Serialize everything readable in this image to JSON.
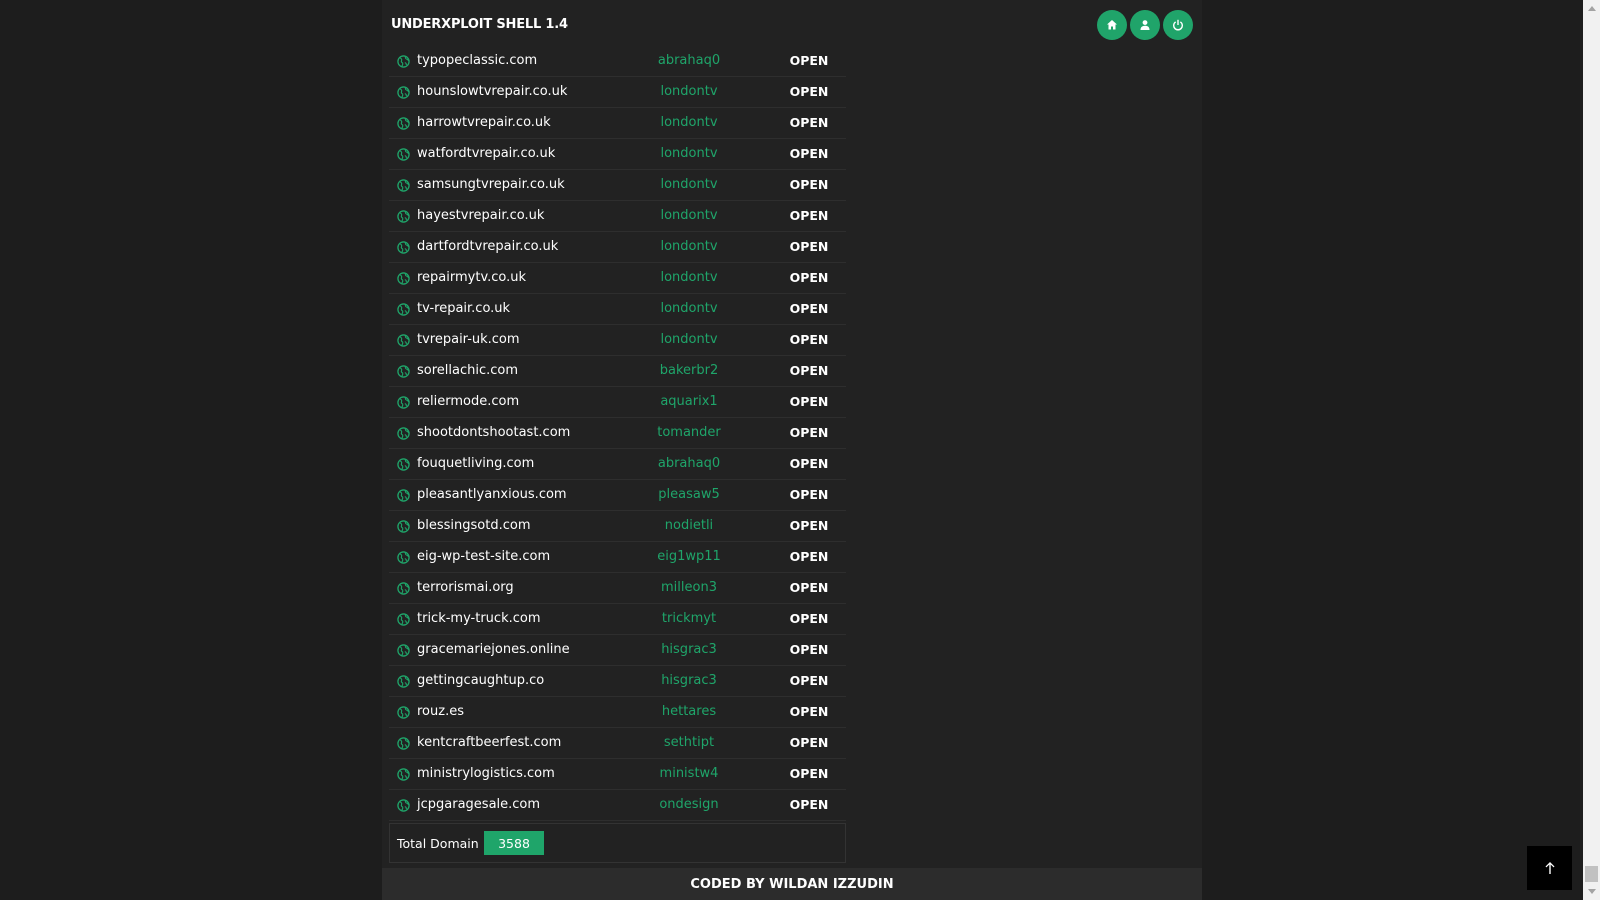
{
  "header": {
    "title": "UNDERXPLOIT SHELL 1.4",
    "buttons": [
      {
        "icon": "home-icon"
      },
      {
        "icon": "user-icon"
      },
      {
        "icon": "power-icon"
      }
    ]
  },
  "domains": [
    {
      "domain": "typopeclassic.com",
      "user": "abrahaq0",
      "status": "OPEN"
    },
    {
      "domain": "hounslowtvrepair.co.uk",
      "user": "londontv",
      "status": "OPEN"
    },
    {
      "domain": "harrowtvrepair.co.uk",
      "user": "londontv",
      "status": "OPEN"
    },
    {
      "domain": "watfordtvrepair.co.uk",
      "user": "londontv",
      "status": "OPEN"
    },
    {
      "domain": "samsungtvrepair.co.uk",
      "user": "londontv",
      "status": "OPEN"
    },
    {
      "domain": "hayestvrepair.co.uk",
      "user": "londontv",
      "status": "OPEN"
    },
    {
      "domain": "dartfordtvrepair.co.uk",
      "user": "londontv",
      "status": "OPEN"
    },
    {
      "domain": "repairmytv.co.uk",
      "user": "londontv",
      "status": "OPEN"
    },
    {
      "domain": "tv-repair.co.uk",
      "user": "londontv",
      "status": "OPEN"
    },
    {
      "domain": "tvrepair-uk.com",
      "user": "londontv",
      "status": "OPEN"
    },
    {
      "domain": "sorellachic.com",
      "user": "bakerbr2",
      "status": "OPEN"
    },
    {
      "domain": "reliermode.com",
      "user": "aquarix1",
      "status": "OPEN"
    },
    {
      "domain": "shootdontshootast.com",
      "user": "tomander",
      "status": "OPEN"
    },
    {
      "domain": "fouquetliving.com",
      "user": "abrahaq0",
      "status": "OPEN"
    },
    {
      "domain": "pleasantlyanxious.com",
      "user": "pleasaw5",
      "status": "OPEN"
    },
    {
      "domain": "blessingsotd.com",
      "user": "nodietli",
      "status": "OPEN"
    },
    {
      "domain": "eig-wp-test-site.com",
      "user": "eig1wp11",
      "status": "OPEN"
    },
    {
      "domain": "terrorismai.org",
      "user": "milleon3",
      "status": "OPEN"
    },
    {
      "domain": "trick-my-truck.com",
      "user": "trickmyt",
      "status": "OPEN"
    },
    {
      "domain": "gracemariejones.online",
      "user": "hisgrac3",
      "status": "OPEN"
    },
    {
      "domain": "gettingcaughtup.co",
      "user": "hisgrac3",
      "status": "OPEN"
    },
    {
      "domain": "rouz.es",
      "user": "hettares",
      "status": "OPEN"
    },
    {
      "domain": "kentcraftbeerfest.com",
      "user": "sethtipt",
      "status": "OPEN"
    },
    {
      "domain": "ministrylogistics.com",
      "user": "ministw4",
      "status": "OPEN"
    },
    {
      "domain": "jcpgaragesale.com",
      "user": "ondesign",
      "status": "OPEN"
    }
  ],
  "total": {
    "label": "Total Domain :",
    "count": "3588"
  },
  "footer": {
    "text": "CODED BY WILDAN IZZUDIN"
  },
  "colors": {
    "accent": "#1fa56a",
    "background": "#1d1d1d",
    "panel": "#222222"
  }
}
